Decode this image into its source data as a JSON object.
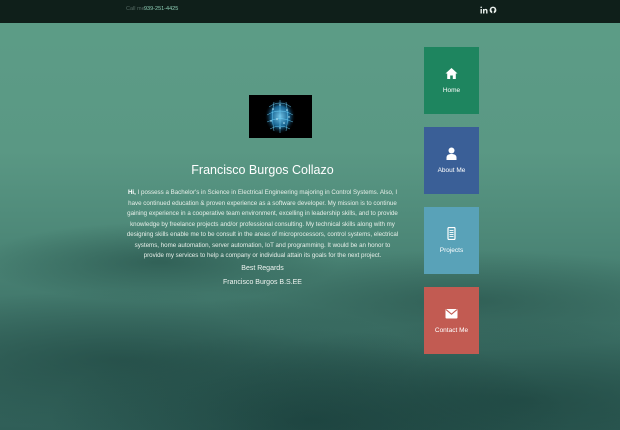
{
  "topbar": {
    "call_label": "Call me",
    "phone": "939-251-4425",
    "social": [
      {
        "icon": "linkedin-icon"
      },
      {
        "icon": "github-icon"
      }
    ]
  },
  "profile": {
    "name": "Francisco Burgos Collazo",
    "greeting": "Hi,",
    "bio": "I possess a Bachelor's in Science in Electrical Engineering majoring in Control Systems. Also, I have continued education & proven experience as a software developer. My mission is to continue gaining experience in a cooperative team environment, excelling in leadership skills, and to provide knowledge by freelance projects and/or professional consulting. My technical skills along with my designing skills enable me to be consult in the areas of microprocessors, control systems, electrical systems, home automation, server automation, IoT and programming. It would be an honor to provide my services to help a company or individual attain its goals for the next project.",
    "regards": "Best Regards",
    "signature": "Francisco Burgos B.S.EE"
  },
  "nav": [
    {
      "label": "Home",
      "icon": "home-icon",
      "color": "#1e855f"
    },
    {
      "label": "About Me",
      "icon": "user-icon",
      "color": "#3a5f97"
    },
    {
      "label": "Projects",
      "icon": "document-icon",
      "color": "#59a2b8"
    },
    {
      "label": "Contact Me",
      "icon": "envelope-icon",
      "color": "#c25b52"
    }
  ],
  "colors": {
    "topbar": "#0f1f1a",
    "phone": "#8fd0b7"
  }
}
